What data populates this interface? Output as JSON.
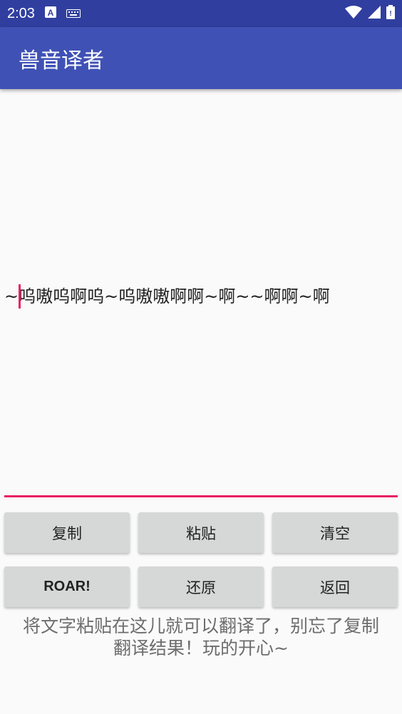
{
  "status_bar": {
    "time": "2:03",
    "icons": [
      "a-notification-icon",
      "keyboard-icon",
      "wifi-icon",
      "signal-icon",
      "battery-icon"
    ]
  },
  "app_bar": {
    "title": "兽音译者"
  },
  "editor": {
    "text": "~呜嗷呜啊呜~呜嗷嗷啊啊~啊~~啊啊~啊"
  },
  "buttons": {
    "copy": "复制",
    "paste": "粘贴",
    "clear": "清空",
    "roar": "ROAR!",
    "restore": "还原",
    "back": "返回"
  },
  "hint": {
    "line1": "将文字粘贴在这儿就可以翻译了，别忘了复制",
    "line2": "翻译结果！玩的开心~"
  },
  "colors": {
    "status_bar": "#303f9f",
    "app_bar": "#3f51b5",
    "accent": "#e91e63",
    "button": "#d6d7d7"
  }
}
